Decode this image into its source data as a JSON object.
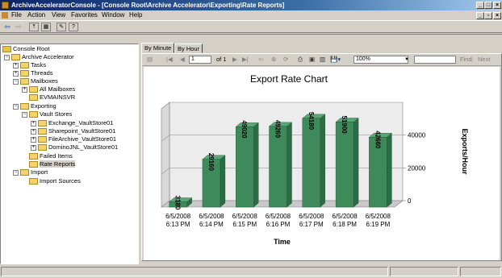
{
  "window": {
    "title": "ArchiveAcceleratorConsole - [Console Root\\Archive Accelerator\\Exporting\\Rate Reports]"
  },
  "menu": [
    "File",
    "Action",
    "View",
    "Favorites",
    "Window",
    "Help"
  ],
  "icons": [
    "back-arrow-icon",
    "forward-arrow-icon",
    "up-folder-icon",
    "show-tree-icon",
    "properties-icon",
    "help-icon"
  ],
  "tree": [
    {
      "label": "Console Root",
      "level": 0,
      "expander": ""
    },
    {
      "label": "Archive Accelerator",
      "level": 1,
      "expander": "-"
    },
    {
      "label": "Tasks",
      "level": 2,
      "expander": "+"
    },
    {
      "label": "Threads",
      "level": 2,
      "expander": "+"
    },
    {
      "label": "Mailboxes",
      "level": 2,
      "expander": "-"
    },
    {
      "label": "All Mailboxes",
      "level": 3,
      "expander": "+"
    },
    {
      "label": "EVMAINSVR",
      "level": 3,
      "expander": ""
    },
    {
      "label": "Exporting",
      "level": 2,
      "expander": "-"
    },
    {
      "label": "Vault Stores",
      "level": 3,
      "expander": "-"
    },
    {
      "label": "Exchange_VaultStore01",
      "level": 4,
      "expander": "+"
    },
    {
      "label": "Sharepoint_VaultStore01",
      "level": 4,
      "expander": "+"
    },
    {
      "label": "FileArchive_VaultStore01",
      "level": 4,
      "expander": "+"
    },
    {
      "label": "DominoJNL_VaultStore01",
      "level": 4,
      "expander": "+"
    },
    {
      "label": "Failed Items",
      "level": 3,
      "expander": ""
    },
    {
      "label": "Rate Reports",
      "level": 3,
      "expander": "",
      "selected": true
    },
    {
      "label": "Import",
      "level": 2,
      "expander": "-"
    },
    {
      "label": "Import Sources",
      "level": 3,
      "expander": ""
    }
  ],
  "tabs": [
    "By Minute",
    "By Hour"
  ],
  "report_toolbar": {
    "page": "1",
    "of": "of 1",
    "zoom": "100%",
    "find": "Find",
    "next": "Next"
  },
  "chart_data": {
    "type": "bar",
    "title": "Export Rate Chart",
    "xlabel": "Time",
    "ylabel": "Exports/Hour",
    "categories": [
      "6/5/2008 6:13 PM",
      "6/5/2008 6:14 PM",
      "6/5/2008 6:15 PM",
      "6/5/2008 6:16 PM",
      "6/5/2008 6:17 PM",
      "6/5/2008 6:18 PM",
      "6/5/2008 6:19 PM"
    ],
    "values": [
      3180,
      29160,
      49020,
      49260,
      54180,
      51900,
      42660
    ],
    "yticks": [
      "0",
      "20000",
      "40000"
    ],
    "ylim": [
      0,
      60000
    ],
    "bar_color": "#3e8a5a",
    "grid": true
  }
}
